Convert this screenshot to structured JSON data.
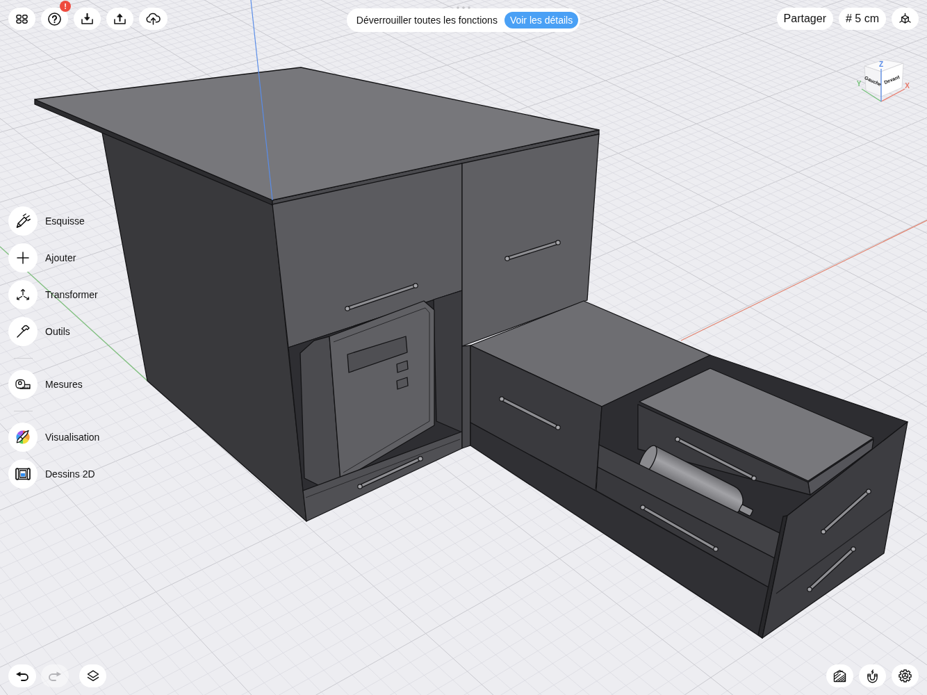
{
  "top_toolbar": {
    "help_badge": "!"
  },
  "promo_banner": {
    "message": "Déverrouiller toutes les fonctions",
    "action": "Voir les détails"
  },
  "top_right": {
    "share": "Partager",
    "grid_size": "# 5 cm"
  },
  "view_cube": {
    "faces": [
      {
        "kind": "left",
        "label": "Gauche"
      },
      {
        "kind": "front",
        "label": "Devant"
      }
    ],
    "axes": [
      {
        "kind": "x",
        "label": "X"
      },
      {
        "kind": "y",
        "label": "Y"
      },
      {
        "kind": "z",
        "label": "Z"
      }
    ]
  },
  "tool_menu": {
    "groups": [
      {
        "items": [
          {
            "kind": "sketch",
            "label": "Esquisse"
          },
          {
            "kind": "add",
            "label": "Ajouter"
          },
          {
            "kind": "transform",
            "label": "Transformer"
          },
          {
            "kind": "tools",
            "label": "Outils"
          }
        ]
      },
      {
        "items": [
          {
            "kind": "measure",
            "label": "Mesures"
          }
        ]
      },
      {
        "items": [
          {
            "kind": "visualize",
            "label": "Visualisation"
          },
          {
            "kind": "drawings",
            "label": "Dessins 2D"
          }
        ]
      }
    ]
  },
  "history": [
    {
      "kind": "undo",
      "disabled": false
    },
    {
      "kind": "redo",
      "disabled": true
    }
  ]
}
